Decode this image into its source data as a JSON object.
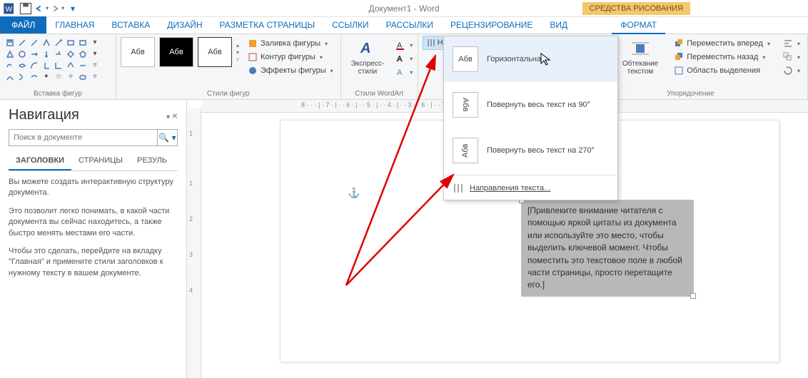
{
  "title": "Документ1 - Word",
  "toolContext": "СРЕДСТВА РИСОВАНИЯ",
  "tabs": {
    "file": "ФАЙЛ",
    "home": "ГЛАВНАЯ",
    "insert": "ВСТАВКА",
    "design": "ДИЗАЙН",
    "layout": "РАЗМЕТКА СТРАНИЦЫ",
    "refs": "ССЫЛКИ",
    "mail": "РАССЫЛКИ",
    "review": "РЕЦЕНЗИРОВАНИЕ",
    "view": "ВИД",
    "format": "ФОРМАТ"
  },
  "ribbon": {
    "shapesGroup": "Вставка фигур",
    "stylesGroup": "Стили фигур",
    "styleSample": "Абв",
    "shapeFill": "Заливка фигуры",
    "shapeOutline": "Контур фигуры",
    "shapeEffects": "Эффекты фигуры",
    "wordartGroup": "Стили WordArt",
    "quickStyles": "Экспресс-стили",
    "textDirection": "Направление текста",
    "wrapText": "Обтекание текстом",
    "bringForward": "Переместить вперед",
    "sendBackward": "Переместить назад",
    "selectionPane": "Область выделения",
    "arrangeGroup": "Упорядочение"
  },
  "dropdown": {
    "sample": "Абв",
    "horizontal": "Горизонтальная",
    "rotate90": "Повернуть весь текст на 90°",
    "rotate270": "Повернуть весь текст на 270°",
    "more": "Направления текста..."
  },
  "nav": {
    "title": "Навигация",
    "placeholder": "Поиск в документе",
    "tabHeadings": "ЗАГОЛОВКИ",
    "tabPages": "СТРАНИЦЫ",
    "tabResults": "РЕЗУЛЬ",
    "p1": "Вы можете создать интерактивную структуру документа.",
    "p2": "Это позволит легко понимать, в какой части документа вы сейчас находитесь, а также быстро менять местами его части.",
    "p3": "Чтобы это сделать, перейдите на вкладку \"Главная\" и примените стили заголовков к нужному тексту в вашем документе."
  },
  "ruler": {
    "v": [
      "1",
      "",
      "1",
      "2",
      "3",
      "4"
    ],
    "h": "8 · · · | · 7 · | · · 6 · | · · 5 · | · · 4 · | · · 3 ·                               · 6 · | · · 7 · | · · 8 · | · · 9 · | · · 10 · |"
  },
  "textbox": "[Привлеките внимание читателя с помощью яркой цитаты из документа или используйте это место, чтобы выделить ключевой момент. Чтобы поместить это текстовое поле в любой части страницы, просто перетащите его.]"
}
